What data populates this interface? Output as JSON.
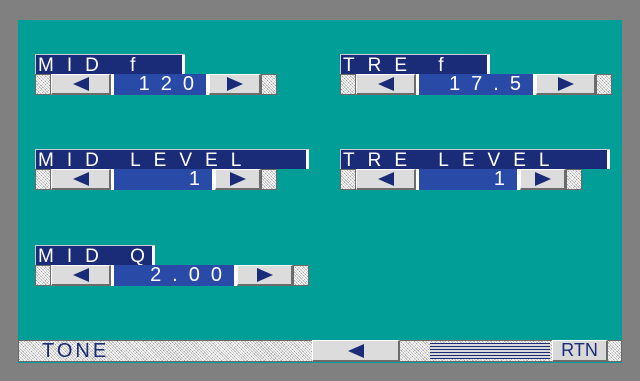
{
  "mid_f": {
    "title": "MID f",
    "value": "120"
  },
  "tre_f": {
    "title": "TRE f",
    "value": "17.5"
  },
  "mid_level": {
    "title": "MID LEVEL",
    "value": "1"
  },
  "tre_level": {
    "title": "TRE LEVEL",
    "value": "1"
  },
  "mid_q": {
    "title": "MID Q",
    "value": "2.00"
  },
  "bottom": {
    "tone_label": "TONE",
    "rtn_label": "RTN"
  },
  "icons": {
    "decrease": "left-triangle-icon",
    "increase": "right-triangle-icon",
    "back": "left-triangle-icon"
  },
  "colors": {
    "background": "#009e96",
    "accent": "#1a2b78",
    "value_bg": "#2a4aa8",
    "frame": "#808080"
  }
}
